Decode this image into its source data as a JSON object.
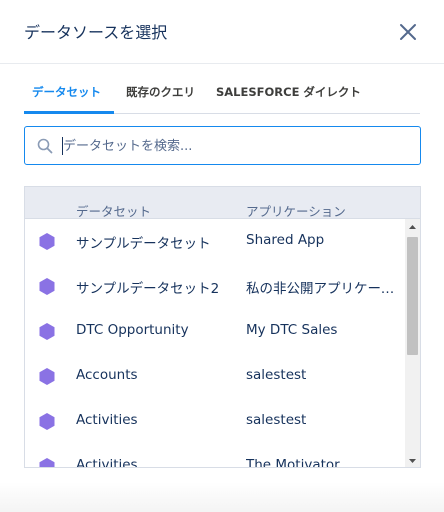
{
  "dialog": {
    "title": "データソースを選択",
    "close_icon": "close-icon"
  },
  "tabs": [
    {
      "label": "データセット",
      "active": true
    },
    {
      "label": "既存のクエリ",
      "active": false
    },
    {
      "label": "SALESFORCE ダイレクト",
      "active": false
    }
  ],
  "search": {
    "placeholder": "データセットを検索...",
    "value": "",
    "icon": "search-icon"
  },
  "table": {
    "columns": [
      "データセット",
      "アプリケーション"
    ],
    "row_icon": "dataset-hexagon-icon",
    "row_icon_color": "#8a72e4",
    "rows": [
      {
        "dataset": "サンプルデータセット",
        "app": "Shared App"
      },
      {
        "dataset": "サンプルデータセット2",
        "app": "私の非公開アプリケーション"
      },
      {
        "dataset": "DTC Opportunity",
        "app": "My DTC Sales"
      },
      {
        "dataset": "Accounts",
        "app": "salestest"
      },
      {
        "dataset": "Activities",
        "app": "salestest"
      },
      {
        "dataset": "Activities",
        "app": "The Motivator"
      }
    ]
  },
  "colors": {
    "accent": "#1589ee",
    "text": "#16325c",
    "header_bg": "#e8ebf2"
  }
}
